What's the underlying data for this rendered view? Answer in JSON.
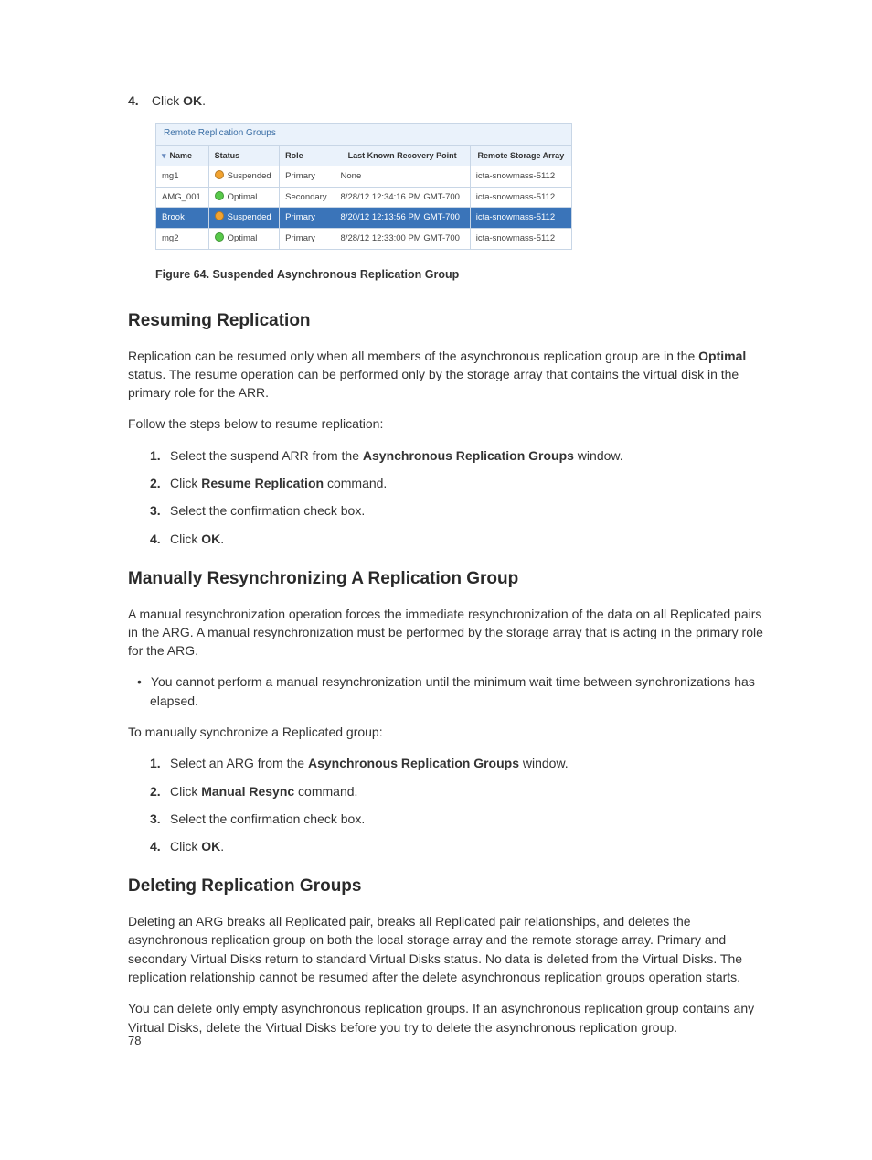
{
  "step4_pre": "Click ",
  "step4_bold": "OK",
  "step4_post": ".",
  "figure": {
    "panel_title": "Remote Replication Groups",
    "columns": {
      "name": "Name",
      "status": "Status",
      "role": "Role",
      "recovery": "Last Known Recovery Point",
      "remote": "Remote Storage Array"
    },
    "rows": [
      {
        "name": "mg1",
        "status": "Suspended",
        "status_kind": "suspended",
        "role": "Primary",
        "recovery": "None",
        "remote": "icta-snowmass-5112",
        "selected": false
      },
      {
        "name": "AMG_001",
        "status": "Optimal",
        "status_kind": "optimal",
        "role": "Secondary",
        "recovery": "8/28/12 12:34:16 PM GMT-700",
        "remote": "icta-snowmass-5112",
        "selected": false
      },
      {
        "name": "Brook",
        "status": "Suspended",
        "status_kind": "suspended",
        "role": "Primary",
        "recovery": "8/20/12 12:13:56 PM GMT-700",
        "remote": "icta-snowmass-5112",
        "selected": true
      },
      {
        "name": "mg2",
        "status": "Optimal",
        "status_kind": "optimal",
        "role": "Primary",
        "recovery": "8/28/12 12:33:00 PM GMT-700",
        "remote": "icta-snowmass-5112",
        "selected": false
      }
    ],
    "caption": "Figure 64. Suspended Asynchronous Replication Group"
  },
  "resuming": {
    "heading": "Resuming Replication",
    "p1_a": "Replication can be resumed only when all members of the asynchronous replication group are in the ",
    "p1_b": "Optimal",
    "p1_c": " status. The resume operation can be performed only by the storage array that contains the virtual disk in the primary role for the ARR.",
    "p2": "Follow the steps below to resume replication:",
    "steps": {
      "s1_a": "Select the suspend ARR from the ",
      "s1_b": "Asynchronous Replication Groups",
      "s1_c": " window.",
      "s2_a": "Click ",
      "s2_b": "Resume Replication",
      "s2_c": " command.",
      "s3": "Select the confirmation check box.",
      "s4_a": "Click ",
      "s4_b": "OK",
      "s4_c": "."
    }
  },
  "resync": {
    "heading": "Manually Resynchronizing A Replication Group",
    "p1": "A manual resynchronization operation forces the immediate resynchronization of the data on all Replicated pairs in the ARG. A manual resynchronization must be performed by the storage array that is acting in the primary role for the ARG.",
    "bullet1": "You cannot perform a manual resynchronization until the minimum wait time between synchronizations has elapsed.",
    "p2": "To manually synchronize a Replicated group:",
    "steps": {
      "s1_a": "Select an ARG from the ",
      "s1_b": "Asynchronous Replication Groups",
      "s1_c": " window.",
      "s2_a": "Click ",
      "s2_b": "Manual Resync",
      "s2_c": " command.",
      "s3": "Select the confirmation check box.",
      "s4_a": "Click ",
      "s4_b": "OK",
      "s4_c": "."
    }
  },
  "deleting": {
    "heading": "Deleting Replication Groups",
    "p1": "Deleting an ARG breaks all Replicated pair, breaks all Replicated pair relationships, and deletes the asynchronous replication group on both the local storage array and the remote storage array. Primary and secondary Virtual Disks return to standard Virtual Disks status. No data is deleted from the Virtual Disks. The replication relationship cannot be resumed after the delete asynchronous replication groups operation starts.",
    "p2": "You can delete only empty asynchronous replication groups. If an asynchronous replication group contains any Virtual Disks, delete the Virtual Disks before you try to delete the asynchronous replication group."
  },
  "page_number": "78"
}
